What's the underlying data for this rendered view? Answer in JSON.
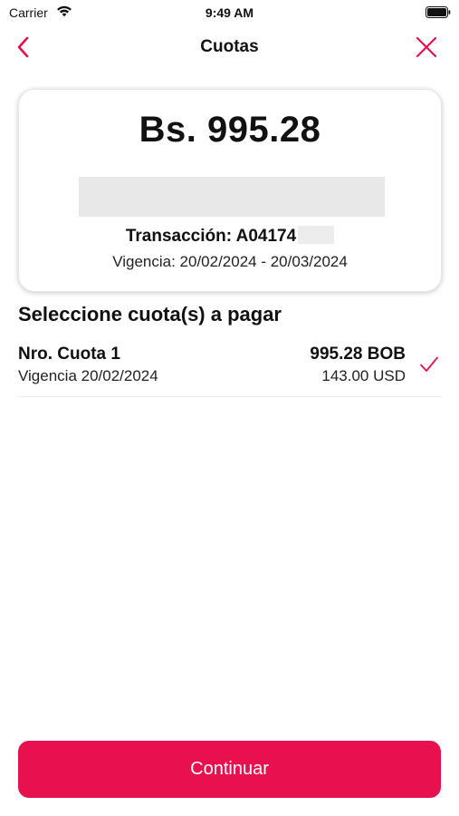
{
  "status_bar": {
    "carrier": "Carrier",
    "time": "9:49 AM",
    "wifi_icon": "wifi-icon",
    "battery_icon": "battery-icon"
  },
  "nav": {
    "title": "Cuotas",
    "back_icon": "chevron-left-icon",
    "close_icon": "close-icon"
  },
  "summary": {
    "amount": "Bs. 995.28",
    "transaction_label": "Transacción: A04174",
    "validity": "Vigencia: 20/02/2024 - 20/03/2024"
  },
  "section": {
    "title": "Seleccione cuota(s) a pagar"
  },
  "installments": [
    {
      "name": "Nro. Cuota 1",
      "validity": "Vigencia 20/02/2024",
      "amount_bob": "995.28 BOB",
      "amount_usd": "143.00 USD",
      "selected": true
    }
  ],
  "footer": {
    "continue_label": "Continuar"
  },
  "colors": {
    "accent": "#e8104f",
    "text": "#111111",
    "background": "#ffffff",
    "redacted": "#e8e8e8"
  }
}
